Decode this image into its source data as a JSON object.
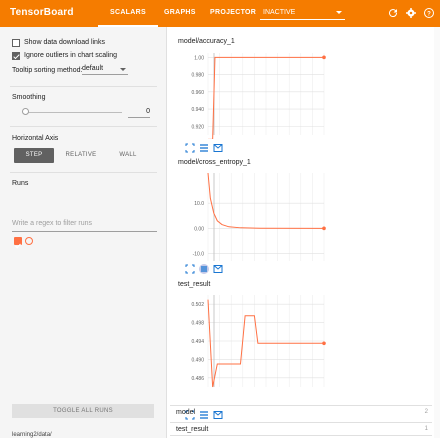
{
  "topbar": {
    "brand": "TensorBoard",
    "tabs": [
      {
        "label": "SCALARS",
        "active": true
      },
      {
        "label": "GRAPHS",
        "active": false
      },
      {
        "label": "PROJECTOR",
        "active": false
      }
    ],
    "inactive_dropdown": "INACTIVE",
    "icons": [
      "refresh-icon",
      "gear-icon",
      "help-icon"
    ],
    "accent_color": "#f57c00"
  },
  "sidebar": {
    "options": [
      {
        "label": "Show data download links",
        "checked": false
      },
      {
        "label": "Ignore outliers in chart scaling",
        "checked": true
      }
    ],
    "tooltip_sorting": {
      "label": "Tooltip sorting method:",
      "value": "default"
    },
    "smoothing": {
      "label": "Smoothing",
      "value": "0"
    },
    "horizontal_axis": {
      "label": "Horizontal Axis",
      "options": [
        {
          "label": "STEP",
          "active": true
        },
        {
          "label": "RELATIVE",
          "active": false
        },
        {
          "label": "WALL",
          "active": false
        }
      ]
    },
    "runs": {
      "label": "Runs",
      "filter_placeholder": "Write a regex to filter runs"
    },
    "toggle_all": "TOGGLE ALL RUNS",
    "data_dir": "learning2/data/"
  },
  "cards": [
    {
      "title": "model/accuracy_1",
      "chart_data": {
        "type": "line",
        "yticks": [
          "1.00",
          "0.980",
          "0.960",
          "0.940",
          "0.920"
        ],
        "ylim": [
          0.91,
          1.005
        ],
        "xlim": [
          0,
          100
        ],
        "series": [
          {
            "color": "#ff7043",
            "points": [
              [
                0,
                0.905
              ],
              [
                4,
                0.905
              ],
              [
                6,
                1.0
              ],
              [
                100,
                1.0
              ]
            ]
          }
        ]
      }
    },
    {
      "title": "model/cross_entropy_1",
      "chart_data": {
        "type": "line",
        "yticks": [
          "10.0",
          "0.00",
          "-10.0"
        ],
        "ylim": [
          -13,
          22
        ],
        "xlim": [
          0,
          100
        ],
        "series": [
          {
            "color": "#ff7043",
            "points": [
              [
                0,
                22
              ],
              [
                2,
                12
              ],
              [
                5,
                6
              ],
              [
                8,
                3
              ],
              [
                12,
                1.5
              ],
              [
                18,
                0.6
              ],
              [
                28,
                0.2
              ],
              [
                45,
                0.05
              ],
              [
                100,
                0
              ]
            ]
          }
        ]
      }
    },
    {
      "title": "test_result",
      "chart_data": {
        "type": "line",
        "yticks": [
          "0.502",
          "0.498",
          "0.494",
          "0.490",
          "0.486"
        ],
        "ylim": [
          0.484,
          0.504
        ],
        "xlim": [
          0,
          100
        ],
        "series": [
          {
            "color": "#ff7043",
            "points": [
              [
                0,
                0.503
              ],
              [
                4,
                0.484
              ],
              [
                8,
                0.489
              ],
              [
                28,
                0.489
              ],
              [
                32,
                0.4995
              ],
              [
                40,
                0.4995
              ],
              [
                43,
                0.4935
              ],
              [
                100,
                0.4935
              ]
            ]
          }
        ]
      }
    }
  ],
  "run_rows": [
    {
      "name": "model",
      "count": "2"
    },
    {
      "name": "test_result",
      "count": "1"
    }
  ]
}
